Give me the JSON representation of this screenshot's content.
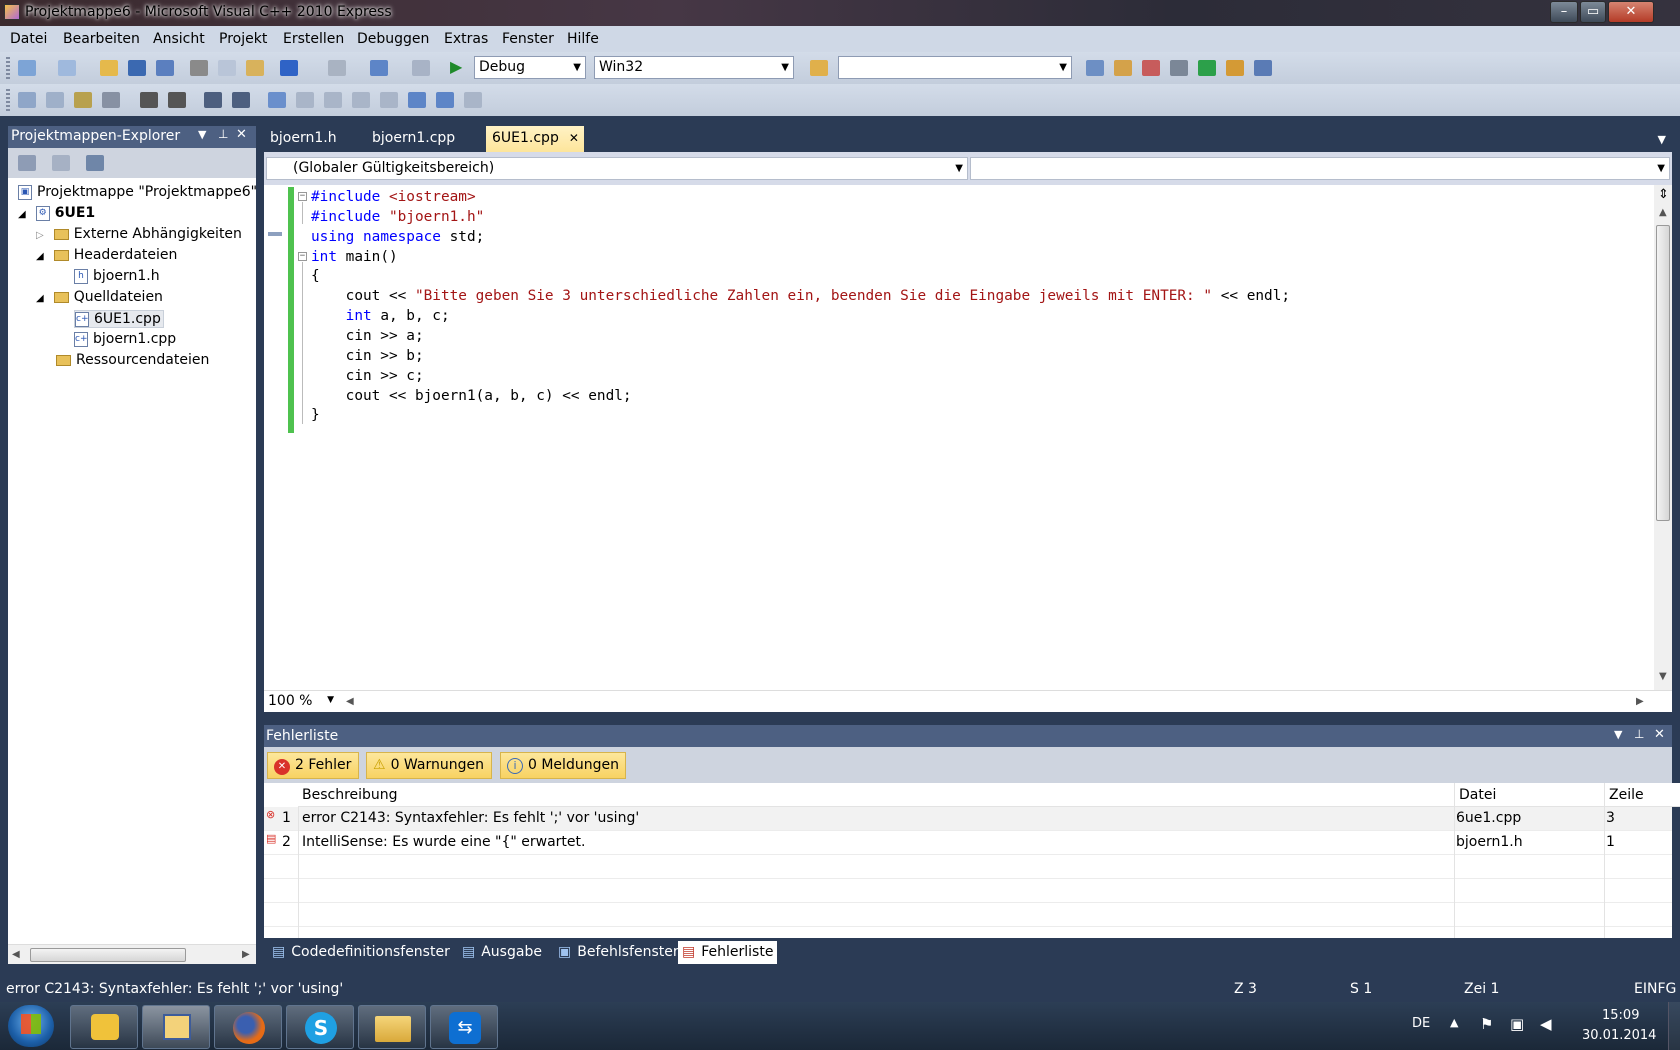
{
  "window": {
    "title": "Projektmappe6 - Microsoft Visual C++ 2010 Express"
  },
  "menu": [
    "Datei",
    "Bearbeiten",
    "Ansicht",
    "Projekt",
    "Erstellen",
    "Debuggen",
    "Extras",
    "Fenster",
    "Hilfe"
  ],
  "toolbar": {
    "config": "Debug",
    "platform": "Win32",
    "find_value": ""
  },
  "solution_explorer": {
    "title": "Projektmappen-Explorer",
    "solution": "Projektmappe \"Projektmappe6\"",
    "project": "6UE1",
    "external": "Externe Abhängigkeiten",
    "headers": "Headerdateien",
    "header_file": "bjoern1.h",
    "sources": "Quelldateien",
    "source_main": "6UE1.cpp",
    "source_other": "bjoern1.cpp",
    "resources": "Ressourcendateien"
  },
  "tabs": [
    "bjoern1.h",
    "bjoern1.cpp",
    "6UE1.cpp"
  ],
  "editor": {
    "scope": "(Globaler Gültigkeitsbereich)",
    "member": "",
    "zoom": "100 %",
    "code": [
      {
        "k": "#include",
        "r": " <iostream>",
        "rc": "str"
      },
      {
        "k": "#include",
        "r": " \"bjoern1.h\"",
        "rc": "str"
      },
      {
        "k": "using",
        "k2": " namespace",
        "r": " std;"
      },
      {
        "k": "int",
        "r": " main()"
      },
      {
        "t": "{"
      },
      {
        "t": "    cout << ",
        "s": "\"Bitte geben Sie 3 unterschiedliche Zahlen ein, beenden Sie die Eingabe jeweils mit ENTER: \"",
        "r": " << endl;"
      },
      {
        "t": "    ",
        "k": "int",
        "r": " a, b, c;"
      },
      {
        "t": "    cin >> a;"
      },
      {
        "t": "    cin >> b;"
      },
      {
        "t": "    cin >> c;"
      },
      {
        "t": "    cout << bjoern1(a, b, c) << endl;"
      },
      {
        "t": "}"
      }
    ]
  },
  "error_list": {
    "title": "Fehlerliste",
    "errors_btn": "2 Fehler",
    "warnings_btn": "0 Warnungen",
    "messages_btn": "0 Meldungen",
    "columns": {
      "desc": "Beschreibung",
      "file": "Datei",
      "line": "Zeile"
    },
    "rows": [
      {
        "n": "1",
        "desc": "error C2143: Syntaxfehler: Es fehlt ';' vor 'using'",
        "file": "6ue1.cpp",
        "line": "3"
      },
      {
        "n": "2",
        "desc": "IntelliSense: Es wurde eine \"{\" erwartet.",
        "file": "bjoern1.h",
        "line": "1"
      }
    ]
  },
  "bottom_tabs": [
    "Codedefinitionsfenster",
    "Ausgabe",
    "Befehlsfenster",
    "Fehlerliste"
  ],
  "status": {
    "message": "error C2143: Syntaxfehler: Es fehlt ';' vor 'using'",
    "z": "Z 3",
    "s": "S 1",
    "zei": "Zei 1",
    "mode": "EINFG"
  },
  "taskbar": {
    "lang": "DE",
    "time": "15:09",
    "date": "30.01.2014"
  }
}
